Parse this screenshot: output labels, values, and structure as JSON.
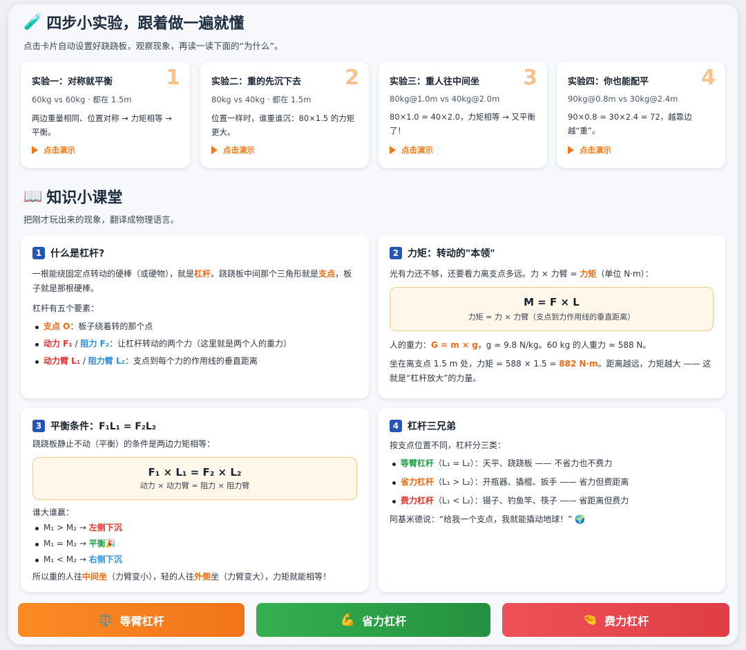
{
  "header": {
    "icon": "test-tube-icon",
    "title": "四步小实验，跟着做一遍就懂",
    "subtitle": "点击卡片自动设置好跷跷板，观察现象，再读一读下面的“为什么”。"
  },
  "experiments": [
    {
      "title": "实验一：对称就平衡",
      "num": "1",
      "meta": "60kg vs 60kg · 都在 1.5m",
      "desc": "两边重量相同、位置对称 → 力矩相等 → 平衡。",
      "play": "点击演示"
    },
    {
      "title": "实验二：重的先沉下去",
      "num": "2",
      "meta": "80kg vs 40kg · 都在 1.5m",
      "desc": "位置一样时，谁重谁沉：80×1.5 的力矩更大。",
      "play": "点击演示"
    },
    {
      "title": "实验三：重人往中间坐",
      "num": "3",
      "meta": "80kg@1.0m vs 40kg@2.0m",
      "desc": "80×1.0 = 40×2.0，力矩相等 → 又平衡了！",
      "play": "点击演示"
    },
    {
      "title": "实验四：你也能配平",
      "num": "4",
      "meta": "90kg@0.8m vs 30kg@2.4m",
      "desc": "90×0.8 = 30×2.4 = 72，越靠边越“重”。",
      "play": "点击演示"
    }
  ],
  "knowledge": {
    "icon": "open-book-icon",
    "title": "知识小课堂",
    "subtitle": "把刚才玩出来的现象，翻译成物理语言。"
  },
  "card1": {
    "num": "1",
    "title": "什么是杠杆?",
    "p1a": "一根能绕固定点转动的硬棒（或硬物），就是",
    "p1b": "杠杆",
    "p1c": "。跷跷板中间那个三角形就是",
    "p1d": "支点",
    "p1e": "，板子就是那根硬棒。",
    "p2": "杠杆有五个要素：",
    "li1a": "支点 O",
    "li1b": "：板子绕着转的那个点",
    "li2a": "动力 F₁",
    "li2b": " / ",
    "li2c": "阻力 F₂",
    "li2d": "：让杠杆转动的两个力（这里就是两个人的重力）",
    "li3a": "动力臂 L₁",
    "li3b": " / ",
    "li3c": "阻力臂 L₂",
    "li3d": "：支点到每个力的作用线的垂直距离"
  },
  "card2": {
    "num": "2",
    "title": "力矩：转动的\"本领\"",
    "p1a": "光有力还不够，还要看力离支点多远。力 × 力臂 = ",
    "p1b": "力矩",
    "p1c": "（单位 N·m）：",
    "formula": "M = F × L",
    "formula_sub": "力矩 = 力 × 力臂（支点到力作用线的垂直距离）",
    "p2a": "人的重力：",
    "p2b": "G = m × g",
    "p2c": "，g ≈ 9.8 N/kg。60 kg 的人重力 ≈ 588 N。",
    "p3a": "坐在离支点 1.5 m 处，力矩 = 588 × 1.5 = ",
    "p3b": "882 N·m",
    "p3c": "。距离越远，力矩越大 —— 这就是“杠杆放大”的力量。"
  },
  "card3": {
    "num": "3",
    "title": "平衡条件：F₁L₁ = F₂L₂",
    "p1": "跷跷板静止不动（平衡）的条件是两边力矩相等：",
    "formula": "F₁ × L₁ = F₂ × L₂",
    "formula_sub": "动力 × 动力臂 = 阻力 × 阻力臂",
    "p2": "谁大谁赢：",
    "li1a": "M₁ > M₂ → ",
    "li1b": "左侧下沉",
    "li2a": "M₁ = M₂ → ",
    "li2b": "平衡",
    "li2c": "🎉",
    "li3a": "M₁ < M₂ → ",
    "li3b": "右侧下沉",
    "p3a": "所以重的人往",
    "p3b": "中间坐",
    "p3c": "（力臂变小），轻的人往",
    "p3d": "外侧",
    "p3e": "坐（力臂变大），力矩就能相等！"
  },
  "card4": {
    "num": "4",
    "title": "杠杆三兄弟",
    "p1": "按支点位置不同，杠杆分三类：",
    "li1a": "等臂杠杆",
    "li1b": "（L₁ = L₂）：天平、跷跷板 —— 不省力也不费力",
    "li2a": "省力杠杆",
    "li2b": "（L₁ > L₂）：开瓶器、撬棍、扳手 —— 省力但费距离",
    "li3a": "费力杠杆",
    "li3b": "（L₁ < L₂）：镊子、钓鱼竿、筷子 —— 省距离但费力",
    "p2": "阿基米德说：“给我一个支点，我就能撬动地球！” 🌍"
  },
  "buttons": [
    {
      "label": "等臂杠杆",
      "icon": "balance-scale-icon",
      "glyph": "⚖️"
    },
    {
      "label": "省力杠杆",
      "icon": "flexed-biceps-icon",
      "glyph": "💪"
    },
    {
      "label": "费力杠杆",
      "icon": "pinching-hand-icon",
      "glyph": "🤏"
    }
  ],
  "colors": {
    "accent_orange": "#ee7a16",
    "btn_orange": "#f7862a",
    "btn_green": "#2fa54a",
    "btn_red": "#e8454b",
    "number_badge": "#2456b8"
  }
}
